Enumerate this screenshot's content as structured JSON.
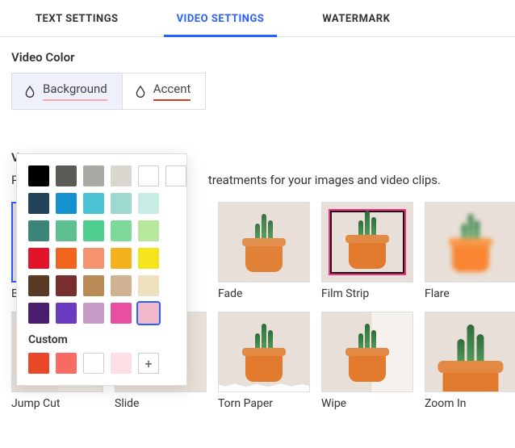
{
  "tabs": {
    "text_settings": "TEXT SETTINGS",
    "video_settings": "VIDEO SETTINGS",
    "watermark": "WATERMARK",
    "active": "video_settings"
  },
  "video_color": {
    "label": "Video Color",
    "background_label": "Background",
    "accent_label": "Accent",
    "active_mode": "background",
    "background_underline_color": "#f6a8a6",
    "accent_underline_color": "#e13b1d"
  },
  "color_picker": {
    "swatches": [
      "#000000",
      "#5a5a57",
      "#a9a9a5",
      "#d9d6cf",
      "#ffffff",
      "#ffffff",
      "#22425a",
      "#1492cf",
      "#4cc3d4",
      "#9ed9cf",
      "#c7ebe5",
      "#ffffff",
      "#3a8478",
      "#5cc18f",
      "#4ecf8f",
      "#7dd99a",
      "#b6e79a",
      "#ffffff",
      "#e3132a",
      "#f0641c",
      "#f5936e",
      "#f3b21c",
      "#f6e51c",
      "#ffffff",
      "#5a3a24",
      "#7a2f2f",
      "#b88a56",
      "#cfb291",
      "#efe1c0",
      "#ffffff",
      "#4a1d6e",
      "#6a3bc0",
      "#c79cc9",
      "#e94fa0",
      "#f1b8c9",
      "#ffffff"
    ],
    "visible_cols": 6,
    "visible_rows": 6,
    "hidden_last_col_after_row1": true,
    "selected_index": 34,
    "custom_label": "Custom",
    "custom_swatches": [
      "#e9472a",
      "#f76b63",
      "#ffffff",
      "#fbdfe4"
    ],
    "add_label": "+"
  },
  "video_styles": {
    "label": "V",
    "desc_prefix": "P",
    "desc_suffix": " treatments for your images and video clips.",
    "items": [
      {
        "key": "basic",
        "label": "B",
        "variant": "basic",
        "selected": true
      },
      {
        "key": "slot1",
        "label": "",
        "variant": "hidden"
      },
      {
        "key": "fade",
        "label": "Fade",
        "variant": "fade"
      },
      {
        "key": "filmstrip",
        "label": "Film Strip",
        "variant": "filmstrip"
      },
      {
        "key": "flare",
        "label": "Flare",
        "variant": "flare"
      },
      {
        "key": "jumpcut",
        "label": "Jump Cut",
        "variant": "jumpcut"
      },
      {
        "key": "slide",
        "label": "Slide",
        "variant": "slide"
      },
      {
        "key": "tornpaper",
        "label": "Torn Paper",
        "variant": "torn"
      },
      {
        "key": "wipe",
        "label": "Wipe",
        "variant": "wipe"
      },
      {
        "key": "zoomin",
        "label": "Zoom In",
        "variant": "zoomin"
      }
    ]
  }
}
